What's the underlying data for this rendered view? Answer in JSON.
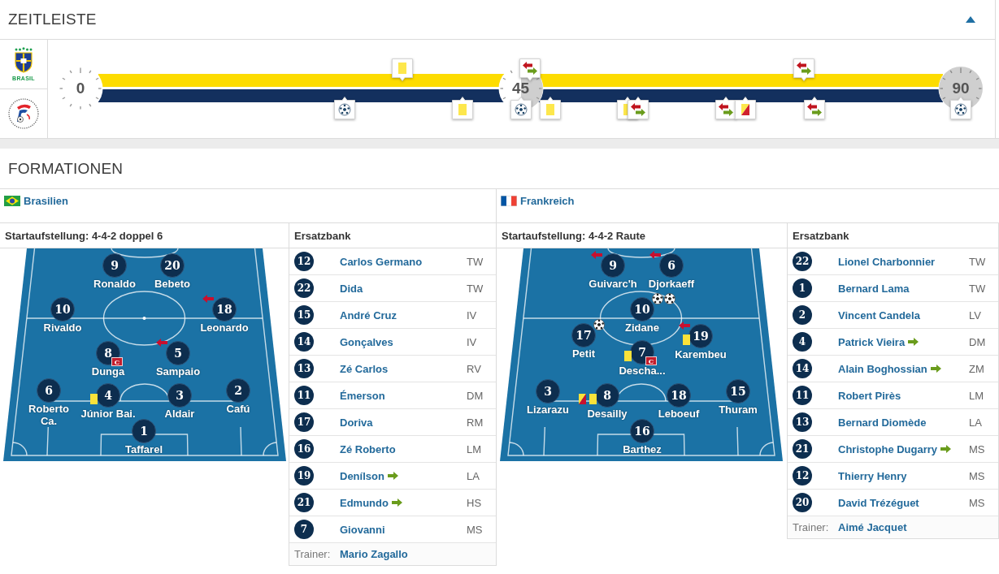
{
  "timeline": {
    "title": "ZEITLEISTE",
    "expanded": true,
    "teams": [
      {
        "kind": "shield",
        "crest_caption": "BRASIL",
        "color": "#fddc00",
        "events": [
          {
            "kind": "yellow_card",
            "level": 0.366
          },
          {
            "kind": "substitution",
            "level": 0.511
          },
          {
            "kind": "substitution",
            "level": 0.822
          }
        ]
      },
      {
        "kind": "roundel",
        "color": "#13305e",
        "events": [
          {
            "kind": "goal",
            "level": 0.3
          },
          {
            "kind": "yellow_card",
            "level": 0.434
          },
          {
            "kind": "goal",
            "level": 0.5
          },
          {
            "kind": "yellow_card",
            "level": 0.534
          },
          {
            "kind": "yellow_card",
            "level": 0.621
          },
          {
            "kind": "substitution",
            "level": 0.633
          },
          {
            "kind": "substitution",
            "level": 0.733
          },
          {
            "kind": "yellow_red_card",
            "level": 0.755
          },
          {
            "kind": "substitution",
            "level": 0.834
          },
          {
            "kind": "goal",
            "level": 1
          }
        ]
      }
    ],
    "clocks": [
      {
        "label": "0",
        "level": 0
      },
      {
        "label": "45",
        "level": 0.5
      },
      {
        "label": "90",
        "level": 1
      }
    ]
  },
  "formations": {
    "title": "FORMATIONEN",
    "teams": [
      {
        "name": "Brasilien",
        "kind": "diamond",
        "lineup": {
          "heading": "Startaufstellung: 4-4-2 doppel 6",
          "kind": "double_six",
          "players": [
            {
              "number": "9",
              "name": "Ronaldo"
            },
            {
              "number": "20",
              "name": "Bebeto"
            },
            {
              "number": "10",
              "name": "Rivaldo"
            },
            {
              "number": "18",
              "name": "Leonardo",
              "events": [
                {
                  "kind": "sub_out"
                }
              ]
            },
            {
              "number": "8",
              "name": "Dunga",
              "captain_badge": "C"
            },
            {
              "number": "5",
              "name": "Sampaio",
              "events": [
                {
                  "kind": "sub_out"
                }
              ]
            },
            {
              "number": "6",
              "name": "Roberto Ca."
            },
            {
              "number": "4",
              "name": "Júnior Bai.",
              "events": [
                {
                  "kind": "yellow_card"
                }
              ]
            },
            {
              "number": "3",
              "name": "Aldair"
            },
            {
              "number": "2",
              "name": "Cafú"
            },
            {
              "number": "1",
              "name": "Taffarel"
            }
          ]
        },
        "bench": {
          "heading": "Ersatzbank",
          "players": [
            {
              "number": "12",
              "name": "Carlos Germano",
              "position": "TW",
              "subbed_in": false
            },
            {
              "number": "22",
              "name": "Dida",
              "position": "TW",
              "subbed_in": false
            },
            {
              "number": "15",
              "name": "André Cruz",
              "position": "IV",
              "subbed_in": false
            },
            {
              "number": "14",
              "name": "Gonçalves",
              "position": "IV",
              "subbed_in": false
            },
            {
              "number": "13",
              "name": "Zé Carlos",
              "position": "RV",
              "subbed_in": false
            },
            {
              "number": "11",
              "name": "Émerson",
              "position": "DM",
              "subbed_in": false
            },
            {
              "number": "17",
              "name": "Doriva",
              "position": "RM",
              "subbed_in": false
            },
            {
              "number": "16",
              "name": "Zé Roberto",
              "position": "LM",
              "subbed_in": false
            },
            {
              "number": "19",
              "name": "Denílson",
              "position": "LA",
              "subbed_in": true
            },
            {
              "number": "21",
              "name": "Edmundo",
              "position": "HS",
              "subbed_in": true
            },
            {
              "number": "7",
              "name": "Giovanni",
              "position": "MS",
              "subbed_in": false
            }
          ],
          "trainer_label": "Trainer:",
          "trainer": "Mario Zagallo"
        }
      },
      {
        "name": "Frankreich",
        "kind": "tricolour",
        "lineup": {
          "heading": "Startaufstellung: 4-4-2 Raute",
          "kind": "diamond",
          "players": [
            {
              "number": "9",
              "name": "Guivarc'h",
              "events": [
                {
                  "kind": "sub_out"
                }
              ]
            },
            {
              "number": "6",
              "name": "Djorkaeff",
              "events": [
                {
                  "kind": "sub_out"
                }
              ]
            },
            {
              "number": "10",
              "name": "Zidane",
              "events": [
                {
                  "kind": "goal"
                },
                {
                  "kind": "goal"
                }
              ]
            },
            {
              "number": "17",
              "name": "Petit",
              "events": [
                {
                  "kind": "goal"
                }
              ]
            },
            {
              "number": "19",
              "name": "Karembeu",
              "events": [
                {
                  "kind": "sub_out"
                },
                {
                  "kind": "yellow_card"
                }
              ]
            },
            {
              "number": "7",
              "name": "Descha...",
              "captain_badge": "C",
              "events": [
                {
                  "kind": "yellow_card"
                }
              ]
            },
            {
              "number": "3",
              "name": "Lizarazu"
            },
            {
              "number": "8",
              "name": "Desailly",
              "events": [
                {
                  "kind": "yellow_card"
                },
                {
                  "kind": "yellow_red_card"
                }
              ]
            },
            {
              "number": "18",
              "name": "Leboeuf"
            },
            {
              "number": "15",
              "name": "Thuram"
            },
            {
              "number": "16",
              "name": "Barthez"
            }
          ]
        },
        "bench": {
          "heading": "Ersatzbank",
          "players": [
            {
              "number": "22",
              "name": "Lionel Charbonnier",
              "position": "TW",
              "subbed_in": false
            },
            {
              "number": "1",
              "name": "Bernard Lama",
              "position": "TW",
              "subbed_in": false
            },
            {
              "number": "2",
              "name": "Vincent Candela",
              "position": "LV",
              "subbed_in": false
            },
            {
              "number": "4",
              "name": "Patrick Vieira",
              "position": "DM",
              "subbed_in": true
            },
            {
              "number": "14",
              "name": "Alain Boghossian",
              "position": "ZM",
              "subbed_in": true
            },
            {
              "number": "11",
              "name": "Robert Pirès",
              "position": "LM",
              "subbed_in": false
            },
            {
              "number": "13",
              "name": "Bernard Diomède",
              "position": "LA",
              "subbed_in": false
            },
            {
              "number": "21",
              "name": "Christophe Dugarry",
              "position": "MS",
              "subbed_in": true
            },
            {
              "number": "12",
              "name": "Thierry Henry",
              "position": "MS",
              "subbed_in": false
            },
            {
              "number": "20",
              "name": "David Trézéguet",
              "position": "MS",
              "subbed_in": false
            }
          ],
          "trainer_label": "Trainer:",
          "trainer": "Aimé Jacquet"
        }
      }
    ]
  }
}
